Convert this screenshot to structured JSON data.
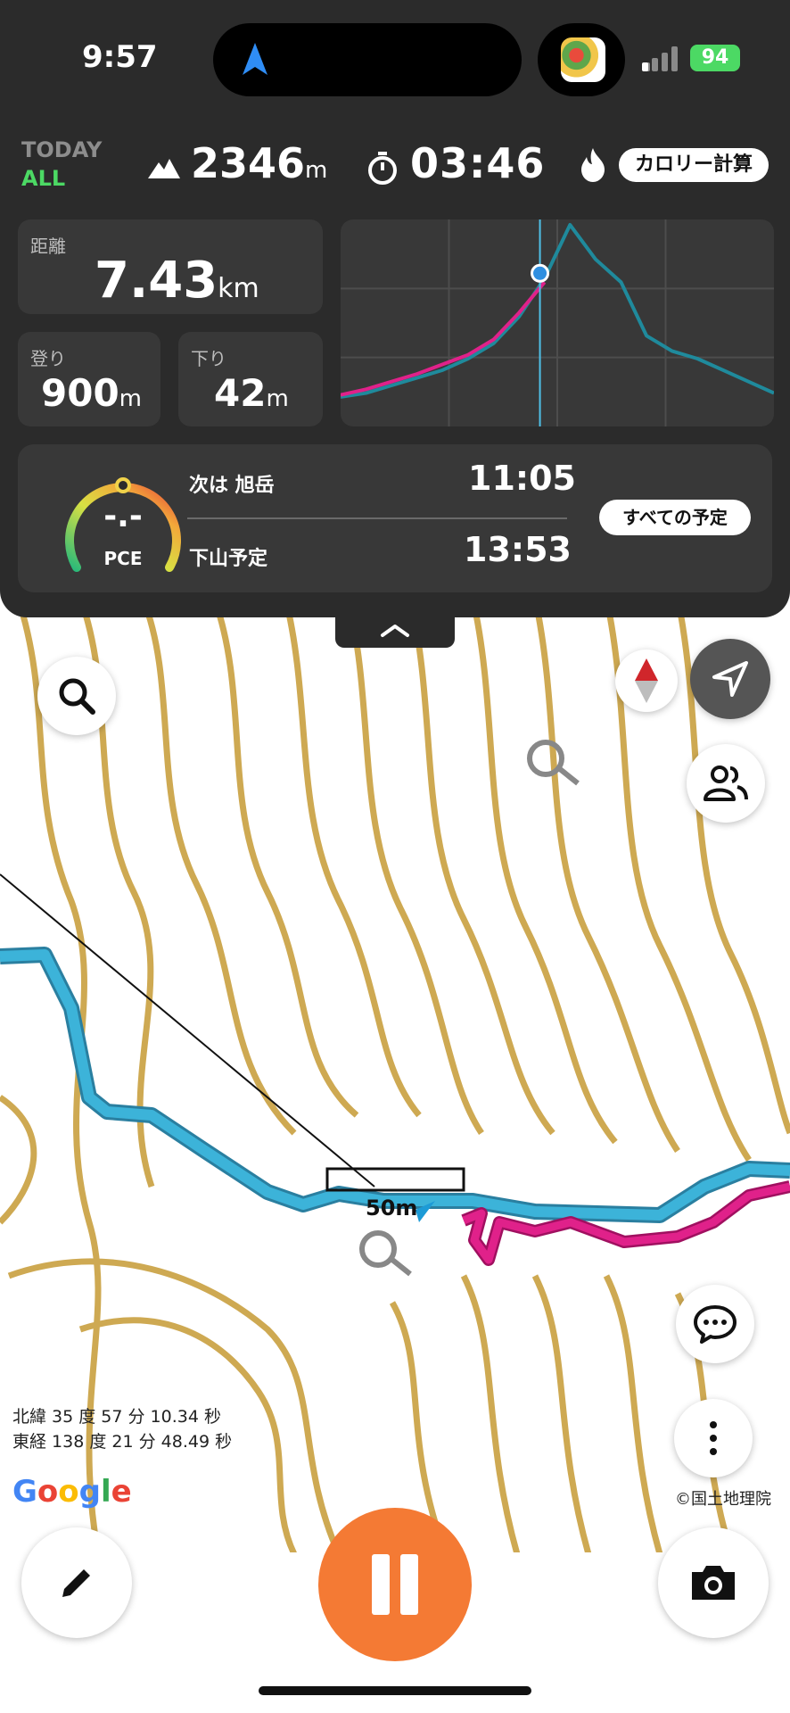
{
  "status_bar": {
    "time": "9:57",
    "battery": "94"
  },
  "stats": {
    "today_label": "TODAY",
    "all_label": "ALL",
    "altitude_value": "2346",
    "altitude_unit": "m",
    "elapsed_time": "03:46",
    "calorie_button": "カロリー計算",
    "distance": {
      "label": "距離",
      "value": "7.43",
      "unit": "km"
    },
    "ascent": {
      "label": "登り",
      "value": "900",
      "unit": "m"
    },
    "descent": {
      "label": "下り",
      "value": "42",
      "unit": "m"
    }
  },
  "chart_data": {
    "type": "line",
    "title": "",
    "xlabel": "",
    "ylabel": "",
    "current_position_fraction": 0.46,
    "series": [
      {
        "color": "#1f8a9c",
        "y": [
          8,
          10,
          14,
          18,
          22,
          28,
          36,
          50,
          70,
          98,
          80,
          68,
          40,
          32,
          28,
          22,
          16,
          10
        ]
      },
      {
        "color": "#e0218a",
        "y": [
          9,
          12,
          16,
          20,
          25,
          30,
          38,
          52,
          68
        ]
      }
    ]
  },
  "schedule": {
    "pce_value": "-.-",
    "pce_label": "PCE",
    "next_label": "次は 旭岳",
    "next_time": "11:05",
    "descent_label": "下山予定",
    "descent_time": "13:53",
    "all_button": "すべての予定"
  },
  "map": {
    "scale_label": "50m",
    "lat": "北緯 35 度 57 分 10.34 秒",
    "lon": "東経 138 度 21 分 48.49 秒",
    "google_logo": "Google",
    "copyright": "©国土地理院",
    "colors": {
      "planned_route": "#3cb3d9",
      "track": "#e0218a",
      "contour": "#c9a040"
    }
  },
  "icons": {
    "search": "search-icon",
    "compass": "compass-icon",
    "location": "location-arrow-icon",
    "people": "people-icon",
    "chat": "chat-icon",
    "more": "more-icon",
    "edit": "pencil-icon",
    "pause": "pause-icon",
    "camera": "camera-icon"
  }
}
